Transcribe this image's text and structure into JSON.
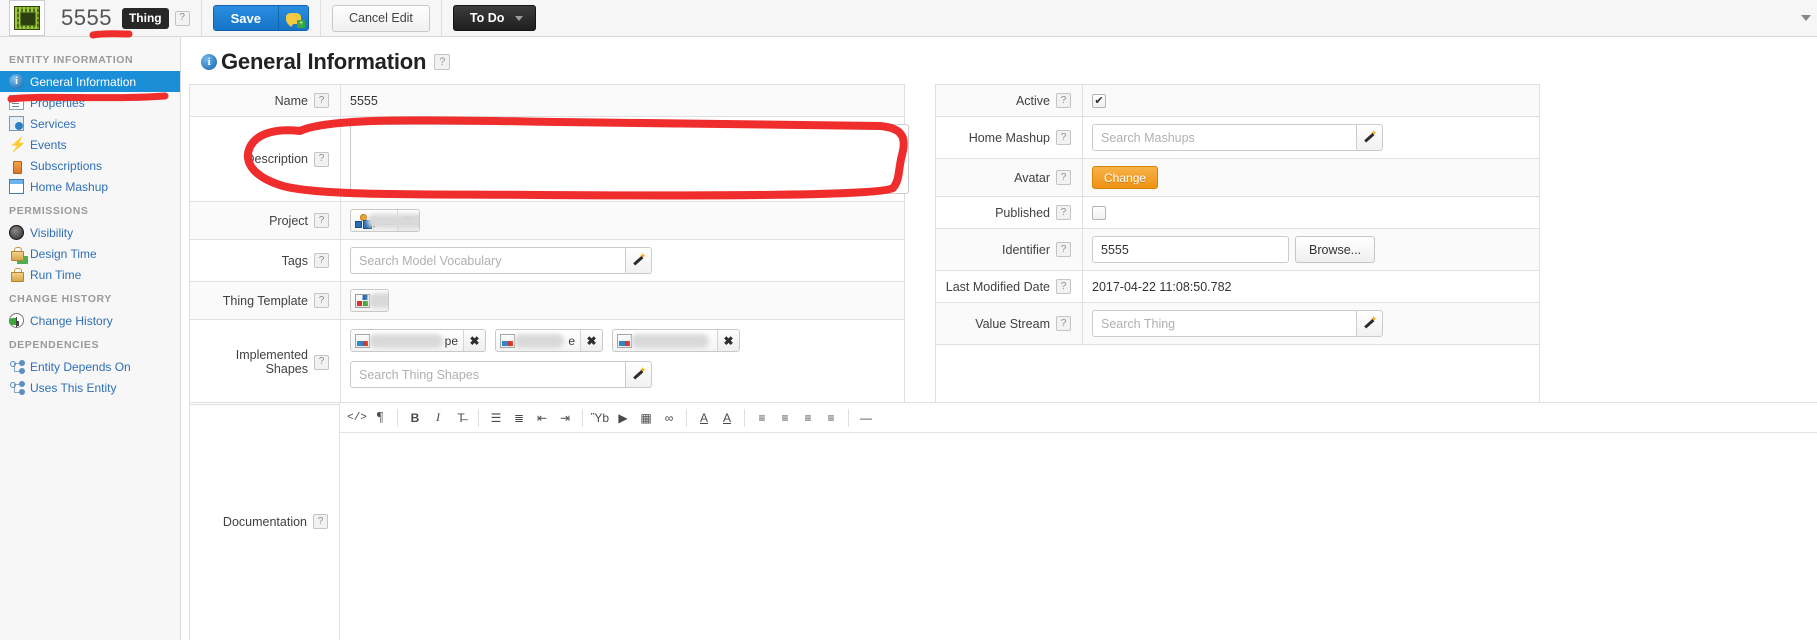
{
  "topbar": {
    "logo_icon": "chip-icon",
    "entity_name": "5555",
    "entity_type_badge": "Thing",
    "help_glyph": "?",
    "save_label": "Save",
    "save_icon": "comment-add-icon",
    "cancel_label": "Cancel Edit",
    "todo_label": "To Do",
    "todo_caret_icon": "chevron-down-icon",
    "right_caret_icon": "chevron-down-icon"
  },
  "sidebar": {
    "groups": [
      {
        "title": "ENTITY INFORMATION",
        "items": [
          {
            "label": "General Information",
            "icon": "info-icon",
            "active": true
          },
          {
            "label": "Properties",
            "icon": "properties-icon",
            "active": false
          },
          {
            "label": "Services",
            "icon": "services-icon",
            "active": false
          },
          {
            "label": "Events",
            "icon": "lightning-icon",
            "active": false
          },
          {
            "label": "Subscriptions",
            "icon": "subscription-icon",
            "active": false
          },
          {
            "label": "Home Mashup",
            "icon": "mashup-icon",
            "active": false
          }
        ]
      },
      {
        "title": "PERMISSIONS",
        "items": [
          {
            "label": "Visibility",
            "icon": "eye-icon",
            "active": false
          },
          {
            "label": "Design Time",
            "icon": "lock-green-icon",
            "active": false
          },
          {
            "label": "Run Time",
            "icon": "lock-icon",
            "active": false
          }
        ]
      },
      {
        "title": "CHANGE HISTORY",
        "items": [
          {
            "label": "Change History",
            "icon": "history-clock-icon",
            "active": false
          }
        ]
      },
      {
        "title": "DEPENDENCIES",
        "items": [
          {
            "label": "Entity Depends On",
            "icon": "dependency-tree-icon",
            "active": false
          },
          {
            "label": "Uses This Entity",
            "icon": "dependency-tree-icon",
            "active": false
          }
        ]
      }
    ]
  },
  "page": {
    "title": "General Information",
    "title_icon": "info-icon",
    "help_glyph": "?"
  },
  "form_left": {
    "name": {
      "label": "Name",
      "value": "5555"
    },
    "description": {
      "label": "Description",
      "value": "",
      "placeholder": ""
    },
    "project": {
      "label": "Project",
      "chip_text": "ject",
      "chip_icon": "project-icon",
      "remove_glyph": "✖"
    },
    "tags": {
      "label": "Tags",
      "value": "",
      "placeholder": "Search Model Vocabulary",
      "wand_icon": "magic-wand-icon"
    },
    "thing_template": {
      "label": "Thing Template",
      "chip_text": "e",
      "chip_icon": "thing-template-icon"
    },
    "implemented_shapes": {
      "label": "Implemented Shapes",
      "chips": [
        {
          "text": "pe",
          "icon": "thing-shape-icon",
          "remove_glyph": "✖"
        },
        {
          "text": "e",
          "icon": "thing-shape-icon",
          "remove_glyph": "✖"
        },
        {
          "text": "",
          "icon": "thing-shape-icon",
          "remove_glyph": "✖"
        }
      ],
      "search_value": "",
      "search_placeholder": "Search Thing Shapes",
      "wand_icon": "magic-wand-icon"
    }
  },
  "form_right": {
    "active": {
      "label": "Active",
      "checked": true,
      "check_glyph": "✔"
    },
    "home_mashup": {
      "label": "Home Mashup",
      "value": "",
      "placeholder": "Search Mashups",
      "wand_icon": "magic-wand-icon"
    },
    "avatar": {
      "label": "Avatar",
      "button_label": "Change"
    },
    "published": {
      "label": "Published",
      "checked": false,
      "check_glyph": ""
    },
    "identifier": {
      "label": "Identifier",
      "value": "5555",
      "browse_label": "Browse..."
    },
    "last_modified_date": {
      "label": "Last Modified Date",
      "value": "2017-04-22 11:08:50.782"
    },
    "value_stream": {
      "label": "Value Stream",
      "value": "",
      "placeholder": "Search Thing",
      "wand_icon": "magic-wand-icon"
    }
  },
  "documentation": {
    "label": "Documentation",
    "content": "",
    "toolbar": [
      {
        "name": "source-code-icon",
        "glyph": "</>"
      },
      {
        "name": "paragraph-icon",
        "glyph": "¶"
      },
      {
        "name": "bold-icon",
        "glyph": "B"
      },
      {
        "name": "italic-icon",
        "glyph": "I"
      },
      {
        "name": "strikethrough-icon",
        "glyph": "T̶"
      },
      {
        "name": "bullet-list-icon",
        "glyph": "☰"
      },
      {
        "name": "numbered-list-icon",
        "glyph": "≣"
      },
      {
        "name": "outdent-icon",
        "glyph": "⇤"
      },
      {
        "name": "indent-icon",
        "glyph": "⇥"
      },
      {
        "name": "image-icon",
        "glyph": "Ὓb"
      },
      {
        "name": "video-icon",
        "glyph": "▶"
      },
      {
        "name": "table-icon",
        "glyph": "▦"
      },
      {
        "name": "link-icon",
        "glyph": "∞"
      },
      {
        "name": "text-color-icon",
        "glyph": "A"
      },
      {
        "name": "highlight-color-icon",
        "glyph": "A"
      },
      {
        "name": "align-left-icon",
        "glyph": "≡"
      },
      {
        "name": "align-center-icon",
        "glyph": "≡"
      },
      {
        "name": "align-right-icon",
        "glyph": "≡"
      },
      {
        "name": "justify-icon",
        "glyph": "≡"
      },
      {
        "name": "horizontal-rule-icon",
        "glyph": "—"
      }
    ]
  },
  "annotations": {
    "color": "#ef2d2d",
    "marks": [
      {
        "name": "underline-thing-badge"
      },
      {
        "name": "underline-general-information-nav"
      },
      {
        "name": "circle-description-field"
      }
    ]
  }
}
